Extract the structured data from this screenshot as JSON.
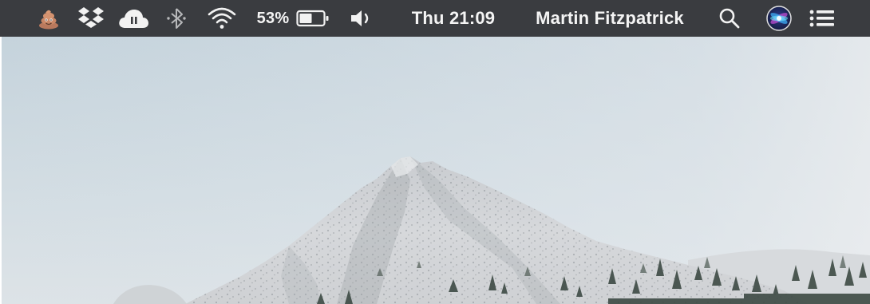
{
  "menubar": {
    "battery": {
      "percent_label": "53%",
      "level": 0.53
    },
    "clock": {
      "label": "Thu 21:09"
    },
    "user": {
      "name": "Martin Fitzpatrick"
    },
    "icons": [
      "poop-emoji-icon",
      "dropbox-icon",
      "cloud-upload-icon",
      "bluetooth-icon",
      "wifi-icon",
      "battery-icon",
      "volume-icon",
      "spotlight-search-icon",
      "siri-icon",
      "notification-center-icon"
    ]
  },
  "desktop": {
    "wallpaper": "snowy-mountain-peak"
  },
  "colors": {
    "menubar_bg": "#3a3c40",
    "menubar_text": "#f4f4f4",
    "sky": "#c9d6de",
    "snow": "#dcdfe2"
  }
}
